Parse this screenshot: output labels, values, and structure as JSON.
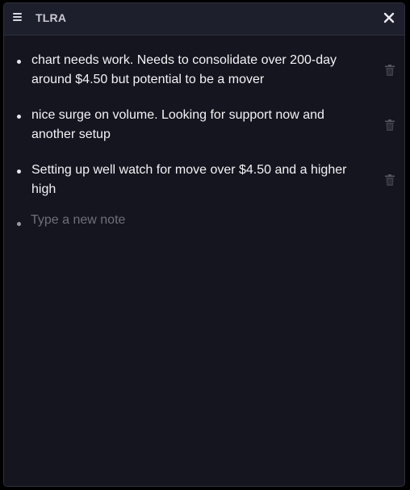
{
  "header": {
    "title": "TLRA",
    "menu_icon": "hamburger-menu-icon",
    "close_icon": "close-x-icon"
  },
  "notes": [
    {
      "text": "chart needs work. Needs to consolidate over 200-day around $4.50 but potential to be a mover",
      "delete_icon": "trash-icon"
    },
    {
      "text": "nice surge on volume. Looking for support now and another setup",
      "delete_icon": "trash-icon"
    },
    {
      "text": "Setting up well watch for move over $4.50 and a higher high",
      "delete_icon": "trash-icon"
    }
  ],
  "new_note": {
    "placeholder": "Type a new note",
    "value": ""
  },
  "colors": {
    "background": "#15151f",
    "header": "#1e1f2c",
    "text": "#f2f2f6",
    "muted": "#6e6f7a"
  }
}
